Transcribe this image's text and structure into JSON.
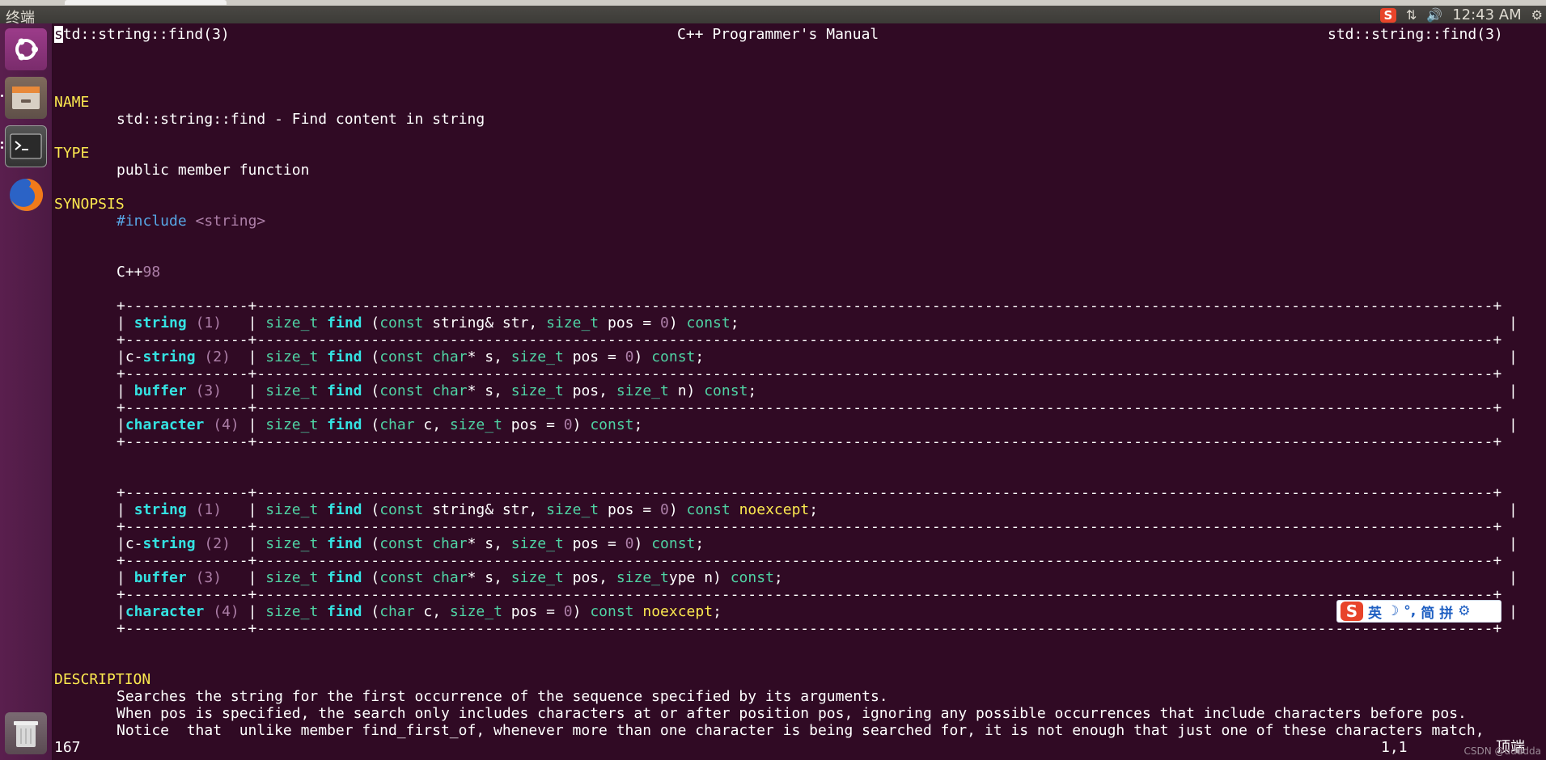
{
  "topbar": {
    "app_title": "终端",
    "clock": "12:43 AM",
    "tray_icons": [
      "sogou-icon",
      "network-arrows-icon",
      "volume-icon",
      "gear-icon"
    ]
  },
  "launcher": {
    "items": [
      "ubuntu-dash-icon",
      "files-icon",
      "terminal-icon",
      "firefox-icon",
      "trash-icon"
    ]
  },
  "header": {
    "left": "std::string::find(3)",
    "center": "C++ Programmer's Manual",
    "right": "std::string::find(3)"
  },
  "sections": {
    "name_heading": "NAME",
    "name_text": "std::string::find - Find content in string",
    "type_heading": "TYPE",
    "type_text": "public member function",
    "synopsis_heading": "SYNOPSIS",
    "include_directive": "#include",
    "include_header": "<string>",
    "standard_prefix": "C++",
    "standard_num": "98",
    "description_heading": "DESCRIPTION"
  },
  "table_border": "+--------------+---------------------------------------------------------------------------------------------------------------------------------------------+",
  "tables": {
    "cpp98": [
      {
        "pre": "| ",
        "name": "string",
        "num": "(1)",
        "gap": "   ",
        "rettype": "size_t",
        "fn": "find",
        "rest": " (const string& str, size_t pos = 0) const;"
      },
      {
        "pre": "|c-",
        "name": "string",
        "num": "(2)",
        "gap": "  ",
        "rettype": "size_t",
        "fn": "find",
        "rest": " (const char* s, size_t pos = 0) const;"
      },
      {
        "pre": "| ",
        "name": "buffer",
        "num": "(3)",
        "gap": "   ",
        "rettype": "size_t",
        "fn": "find",
        "rest": " (const char* s, size_t pos, size_t n) const;"
      },
      {
        "pre": "|",
        "name": "character",
        "num": "(4)",
        "gap": " ",
        "rettype": "size_t",
        "fn": "find",
        "rest": " (char c, size_t pos = 0) const;"
      }
    ],
    "cpp11": [
      {
        "pre": "| ",
        "name": "string",
        "num": "(1)",
        "gap": "   ",
        "rettype": "size_t",
        "fn": "find",
        "rest": " (const string& str, size_t pos = 0) const noexcept;"
      },
      {
        "pre": "|c-",
        "name": "string",
        "num": "(2)",
        "gap": "  ",
        "rettype": "size_t",
        "fn": "find",
        "rest": " (const char* s, size_t pos = 0) const;"
      },
      {
        "pre": "| ",
        "name": "buffer",
        "num": "(3)",
        "gap": "   ",
        "rettype": "size_t",
        "fn": "find",
        "rest": " (const char* s, size_t pos, size_type n) const;"
      },
      {
        "pre": "|",
        "name": "character",
        "num": "(4)",
        "gap": " ",
        "rettype": "size_t",
        "fn": "find",
        "rest": " (char c, size_t pos = 0) const noexcept;"
      }
    ]
  },
  "description_lines": [
    "Searches the string for the first occurrence of the sequence specified by its arguments.",
    "When pos is specified, the search only includes characters at or after position pos, ignoring any possible occurrences that include characters before pos.",
    "Notice  that  unlike member find_first_of, whenever more than one character is being searched for, it is not enough that just one of these characters match,"
  ],
  "status_bar": {
    "line_number": "167",
    "position": "1,1",
    "scroll": "顶端"
  },
  "ime_toolbar": {
    "logo": "S",
    "items": [
      "英",
      "☽",
      "°,",
      "简",
      "拼",
      "⚙"
    ]
  },
  "watermark": "CSDN @ddddda"
}
